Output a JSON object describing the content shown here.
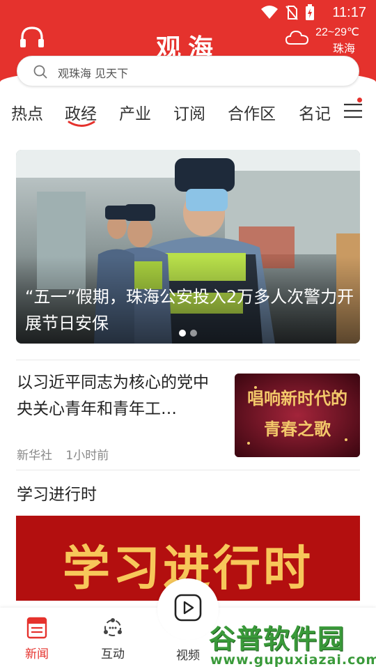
{
  "status_bar": {
    "time": "11:17"
  },
  "header": {
    "title": "观海",
    "weather": {
      "temperature": "22~29℃",
      "city": "珠海"
    },
    "headset_icon": "headset-icon"
  },
  "search": {
    "placeholder": "观珠海 见天下"
  },
  "tabs": [
    {
      "label": "热点"
    },
    {
      "label": "政经",
      "selected": true
    },
    {
      "label": "产业"
    },
    {
      "label": "订阅"
    },
    {
      "label": "合作区"
    },
    {
      "label": "名记"
    }
  ],
  "hero": {
    "caption": "“五一”假期，珠海公安投入2万多人次警力开展节日安保",
    "slide_count": 2,
    "active_slide": 1
  },
  "article": {
    "title": "以习近平同志为核心的党中央关心青年和青年工…",
    "source": "新华社",
    "time": "1小时前",
    "thumbnail_text": "唱响新时代的青春之歌"
  },
  "section": {
    "title": "学习进行时",
    "banner_text": "学习进行时"
  },
  "bottom_nav": [
    {
      "label": "新闻",
      "icon": "news-icon",
      "active": true
    },
    {
      "label": "互动",
      "icon": "interact-icon"
    },
    {
      "label": "视频",
      "icon": "video-icon"
    }
  ],
  "watermark": {
    "main": "谷普软件园",
    "sub": "www.gupuxiazai.com"
  },
  "colors": {
    "brand_red": "#e5322d",
    "banner_red": "#b30f0f",
    "gold": "#f7c75a"
  }
}
